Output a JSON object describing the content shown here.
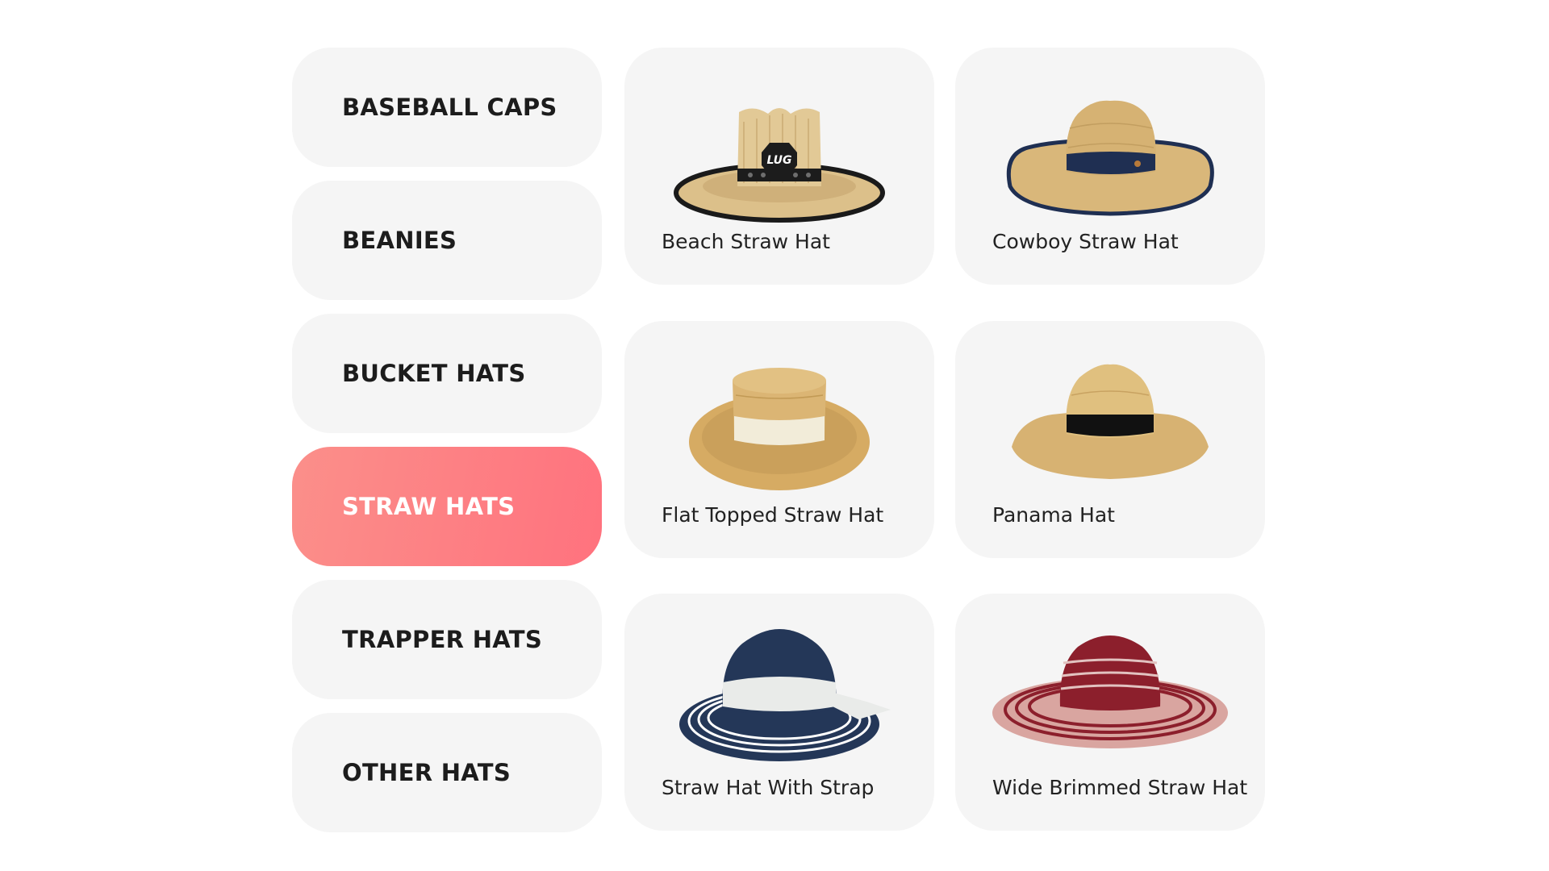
{
  "categories": [
    {
      "label": "BASEBALL CAPS",
      "active": false
    },
    {
      "label": "BEANIES",
      "active": false
    },
    {
      "label": "BUCKET HATS",
      "active": false
    },
    {
      "label": "STRAW HATS",
      "active": true
    },
    {
      "label": "TRAPPER HATS",
      "active": false
    },
    {
      "label": "OTHER HATS",
      "active": false
    }
  ],
  "products": [
    {
      "name": "Beach Straw Hat",
      "image": "beach-straw-hat-image"
    },
    {
      "name": "Cowboy Straw Hat",
      "image": "cowboy-straw-hat-image"
    },
    {
      "name": "Flat Topped Straw Hat",
      "image": "flat-topped-straw-hat-image"
    },
    {
      "name": "Panama Hat",
      "image": "panama-hat-image"
    },
    {
      "name": "Straw Hat With Strap",
      "image": "straw-hat-with-strap-image"
    },
    {
      "name": "Wide Brimmed Straw Hat",
      "image": "wide-brimmed-straw-hat-image"
    }
  ],
  "beach_hat_logo": "LUG",
  "colors": {
    "active_gradient_start": "#fb8f8a",
    "active_gradient_end": "#ff727e",
    "tile_background": "#f5f5f5",
    "straw": "#d9b77a",
    "navy": "#1f2f52",
    "burgundy": "#8c1f2c"
  }
}
